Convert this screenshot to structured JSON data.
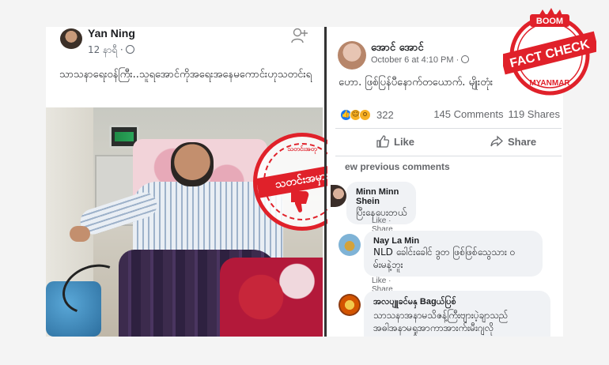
{
  "left_post": {
    "author": "Yan Ning",
    "time": "12 နာရီ ·",
    "caption": "သာသနာရေးဝန်ကြီး..သူရအောင်ကိုအရေးအနေမကောင်းဟုသတင်းရ"
  },
  "stamp": {
    "top_text": "သတင်းအတု",
    "label": "သတင်းအမှား"
  },
  "right_post": {
    "author": "အောင် အောင်",
    "time": "October 6 at 4:10 PM ·",
    "caption": "ဟော. ဖြစ်ပြန်ပီနောက်တယောက်. မျိုးတုံး",
    "reaction_count": "322",
    "comments_count": "145 Comments",
    "shares_count": "119 Shares",
    "like_label": "Like",
    "share_label": "Share",
    "previous_comments": "ew previous comments",
    "comments": [
      {
        "name": "Minn Minn Shein",
        "text": "ပြီးနေပေးတယ်",
        "actions": "Like · Share · 19h"
      },
      {
        "name": "Nay La Min",
        "text": "NLD ခေါင်းခေါင် ဒွတ ဖြစ်ဖြစ်သွေသား ဝ",
        "text2": "မ်းမနဲ့ဘူး",
        "actions": "Like · Share · 16h"
      },
      {
        "name": "အလပျူခင်မနှ Bagယ်ပြစ်",
        "text": "သာသနာအနာမသိဇန့်ကြီးဗျားပဲ့ချာသည်",
        "text2": "အဓါအနာမရှုအာကာအားက်းမီးဂျလို"
      }
    ]
  },
  "fact_check": {
    "top": "BOOM",
    "main": "FACT CHECK",
    "bottom": "MYANMAR",
    "color": "#e0212a"
  }
}
